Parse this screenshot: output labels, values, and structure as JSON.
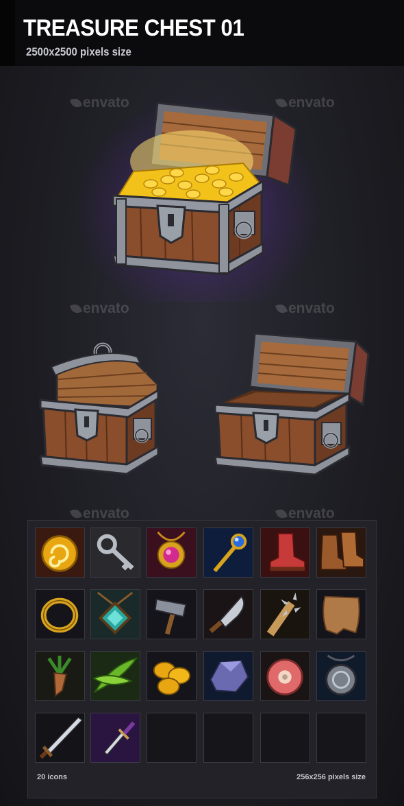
{
  "header": {
    "title": "TREASURE CHEST 01",
    "subtitle": "2500x2500 pixels size"
  },
  "watermark": {
    "text": "envato"
  },
  "footer": {
    "icon_count": "20 icons",
    "icon_size": "256x256 pixels size"
  },
  "colors": {
    "background": "#1c1c22",
    "header_bg": "#0b0b0d",
    "gold": "#f2c21a",
    "wood": "#8a4e2c",
    "metal": "#8f939c",
    "purple_glow": "#6a3cc8"
  },
  "chests": [
    {
      "name": "chest-open-gold-icon"
    },
    {
      "name": "chest-closed-icon"
    },
    {
      "name": "chest-open-empty-icon"
    }
  ],
  "icons": [
    "gold-coin-icon",
    "key-icon",
    "amulet-icon",
    "scepter-icon",
    "red-boot-icon",
    "brown-boots-icon",
    "gold-ring-icon",
    "teal-gem-pendant-icon",
    "hammer-icon",
    "cleaver-icon",
    "spiked-club-icon",
    "leather-hide-icon",
    "root-herb-icon",
    "green-leaf-icon",
    "gold-coins-icon",
    "crystal-ore-icon",
    "meat-steak-icon",
    "silver-medallion-icon",
    "sword-icon",
    "dagger-icon",
    "empty-slot",
    "empty-slot",
    "empty-slot",
    "empty-slot"
  ]
}
